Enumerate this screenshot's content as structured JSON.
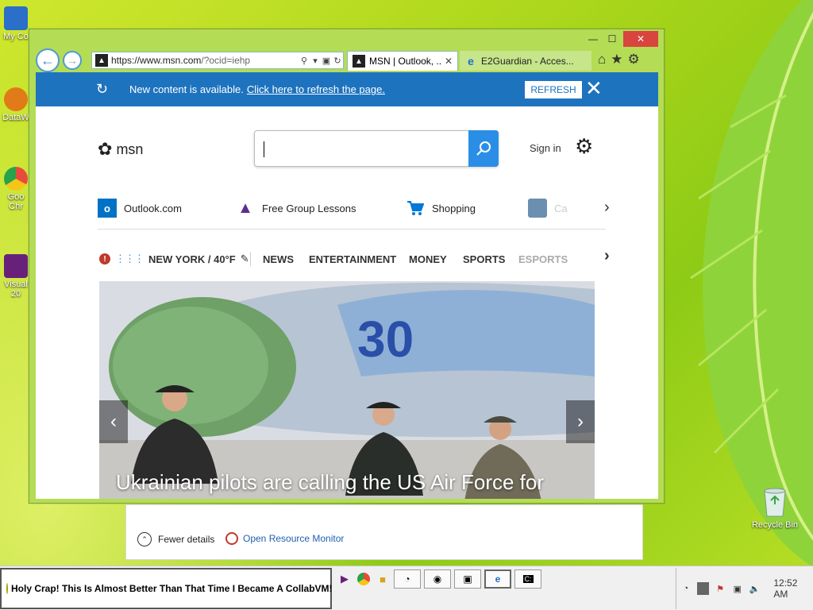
{
  "desktop": {
    "icons": [
      {
        "label": "My Co",
        "color": "#2b6fc9"
      },
      {
        "label": "DataW",
        "color": "#e07b18"
      },
      {
        "label": "Goo Chr",
        "color": "#e84a3c"
      },
      {
        "label": "Visual 20",
        "color": "#68217a"
      }
    ],
    "recycle_label": "Recycle Bin"
  },
  "behind_window": {
    "fewer_details": "Fewer details",
    "open_resource_monitor": "Open Resource Monitor"
  },
  "browser": {
    "controls": {
      "minimize": "—",
      "maximize": "☐",
      "close": "✕"
    },
    "back_glyph": "←",
    "forward_glyph": "→",
    "address": {
      "url_host": "https://www.msn.com",
      "url_path": "/?ocid=iehp"
    },
    "tabs": [
      {
        "title": "MSN | Outlook, ...",
        "active": true,
        "close": "✕"
      },
      {
        "title": "E2Guardian - Acces...",
        "active": false
      }
    ],
    "toolbar_icons": [
      "home-icon",
      "favorites-star-icon",
      "tools-gear-icon"
    ]
  },
  "msn": {
    "notification": {
      "text": "New content is available.",
      "link": "Click here to refresh the page.",
      "refresh_button": "REFRESH",
      "close": "✕"
    },
    "logo_text": "msn",
    "search": {
      "placeholder": ""
    },
    "sign_in": "Sign in",
    "quick_links": [
      {
        "label": "Outlook.com",
        "icon": "outlook-icon",
        "color": "#0072c6"
      },
      {
        "label": "Free Group Lessons",
        "icon": "graduation-cap-icon",
        "color": "#5c2d91"
      },
      {
        "label": "Shopping",
        "icon": "shopping-cart-icon",
        "color": "#0078d7"
      },
      {
        "label": "Ca",
        "icon": "car-icon",
        "color": "#6a8fb0"
      }
    ],
    "weather": {
      "location": "NEW YORK / 40°F"
    },
    "categories": [
      "NEWS",
      "ENTERTAINMENT",
      "MONEY",
      "SPORTS",
      "ESPORTS"
    ],
    "hero": {
      "headline": "Ukrainian pilots are calling the US Air Force for",
      "aircraft_number": "30"
    }
  },
  "taskbar": {
    "chat_message": "Holy Crap! This Is Almost Better Than That Time I Became A CollabVM!",
    "pinned": [
      "visual-studio-icon",
      "chrome-icon",
      "file-explorer-icon"
    ],
    "windows": [
      "task-manager-window",
      "network-window",
      "remote-window",
      "ie-window",
      "cmd-window"
    ],
    "clock": "12:52 AM"
  },
  "colors": {
    "msn_blue": "#1e73be",
    "window_frame": "#b4dc55",
    "close_red": "#d9443f"
  }
}
